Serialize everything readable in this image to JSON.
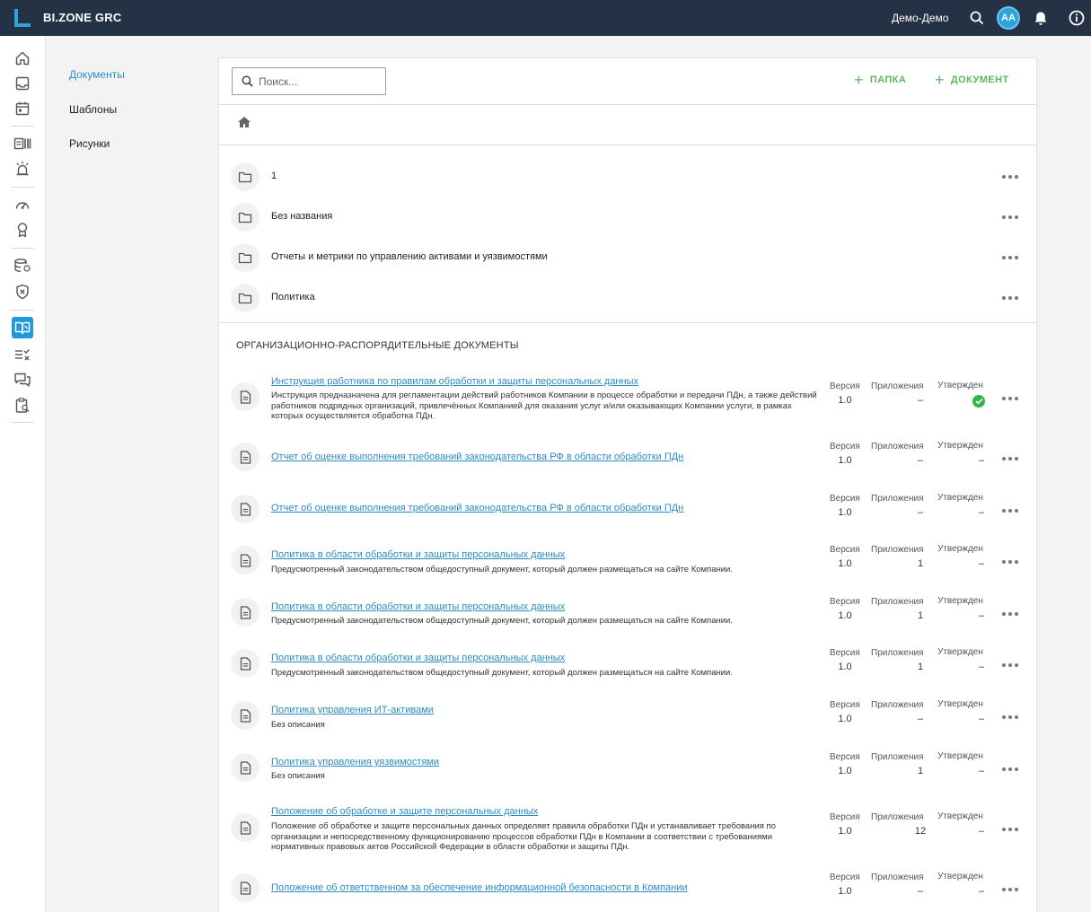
{
  "app": {
    "title": "BI.ZONE GRC"
  },
  "topbar": {
    "user_name": "Демо-Демо",
    "avatar_initials": "AA"
  },
  "subnav": {
    "items": [
      {
        "label": "Документы"
      },
      {
        "label": "Шаблоны"
      },
      {
        "label": "Рисунки"
      }
    ]
  },
  "toolbar": {
    "search_placeholder": "Поиск...",
    "add_folder_label": "ПАПКА",
    "add_document_label": "ДОКУМЕНТ"
  },
  "folders": [
    {
      "name": "1"
    },
    {
      "name": "Без названия"
    },
    {
      "name": "Отчеты и метрики по управлению активами и уязвимостями"
    },
    {
      "name": "Политика"
    }
  ],
  "section_title": "ОРГАНИЗАЦИОННО-РАСПОРЯДИТЕЛЬНЫЕ ДОКУМЕНТЫ",
  "meta_labels": {
    "version": "Версия",
    "attachments": "Приложения",
    "approved": "Утвержден"
  },
  "documents": [
    {
      "title": "Инструкция работника по правилам обработки и защиты персональных данных",
      "description": "Инструкция предназначена для регламентации действий работников Компании в процессе обработки и передачи ПДн, а также действий работников подрядных организаций, привлечённых Компанией для оказания услуг и/или оказывающих Компании услуги, в рамках которых осуществляется обработка ПДн.",
      "version": "1.0",
      "attachments": "–",
      "approved": "check"
    },
    {
      "title": "Отчет об оценке выполнения требований законодательства РФ в области обработки ПДн",
      "description": "",
      "version": "1.0",
      "attachments": "–",
      "approved": "–"
    },
    {
      "title": "Отчет об оценке выполнения требований законодательства РФ в области обработки ПДн",
      "description": "",
      "version": "1.0",
      "attachments": "–",
      "approved": "–"
    },
    {
      "title": "Политика в области обработки и защиты персональных данных",
      "description": "Предусмотренный законодательством общедоступный документ, который должен размещаться на сайте Компании.",
      "version": "1.0",
      "attachments": "1",
      "approved": "–"
    },
    {
      "title": "Политика в области обработки и защиты персональных данных",
      "description": "Предусмотренный законодательством общедоступный документ, который должен размещаться на сайте Компании.",
      "version": "1.0",
      "attachments": "1",
      "approved": "–"
    },
    {
      "title": "Политика в области обработки и защиты персональных данных",
      "description": "Предусмотренный законодательством общедоступный документ, который должен размещаться на сайте Компании.",
      "version": "1.0",
      "attachments": "1",
      "approved": "–"
    },
    {
      "title": "Политика управления ИТ-активами",
      "description": "Без описания",
      "version": "1.0",
      "attachments": "–",
      "approved": "–"
    },
    {
      "title": "Политика управления уязвимостями",
      "description": "Без описания",
      "version": "1.0",
      "attachments": "1",
      "approved": "–"
    },
    {
      "title": "Положение об обработке и защите персональных данных",
      "description": "Положение об обработке и защите персональных данных определяет правила обработки ПДн и устанавливает требования по организации и непосредственному функционированию процессов обработки ПДн в Компании в соответствии с требованиями нормативных правовых актов Российской Федерации в области обработки и защиты ПДн.",
      "version": "1.0",
      "attachments": "12",
      "approved": "–"
    },
    {
      "title": "Положение об ответственном за обеспечение информационной безопасности в Компании",
      "description": "",
      "version": "1.0",
      "attachments": "–",
      "approved": "–"
    }
  ]
}
